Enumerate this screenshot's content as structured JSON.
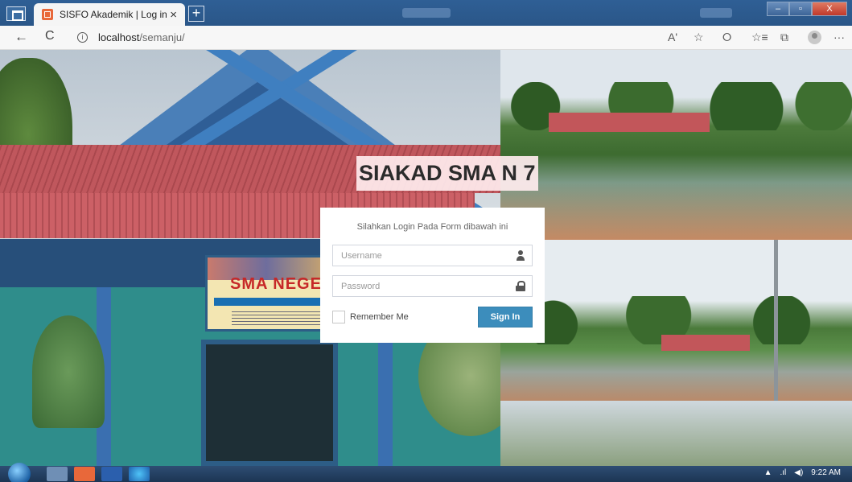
{
  "browser": {
    "tab_title": "SISFO Akademik | Log in",
    "tab_close": "×",
    "new_tab": "+",
    "url_host": "localhost",
    "url_path": "/semanju/",
    "icons": {
      "back": "←",
      "refresh": "C",
      "info": "i",
      "read_aloud": "Aʹ",
      "favorite_add": "☆",
      "extensions": "⭘",
      "favorites": "☆≡",
      "collections": "⧉",
      "more": "···"
    }
  },
  "window_buttons": {
    "minimize": "–",
    "maximize": "▫",
    "close": "X"
  },
  "page": {
    "heading": "SIAKAD SMA N 7",
    "login_message": "Silahkan Login Pada Form dibawah ini",
    "username_placeholder": "Username",
    "password_placeholder": "Password",
    "remember_label": "Remember Me",
    "signin_label": "Sign In",
    "banner_text": "SMA NEGERI"
  },
  "taskbar": {
    "clock": "9:22 AM",
    "tray_up": "▲",
    "tray_network": ".ıl",
    "tray_volume": "◀)"
  },
  "colors": {
    "primary_button": "#3c8dbc",
    "title_bar": "#2f5f95",
    "heading_bg": "#ffebee"
  }
}
